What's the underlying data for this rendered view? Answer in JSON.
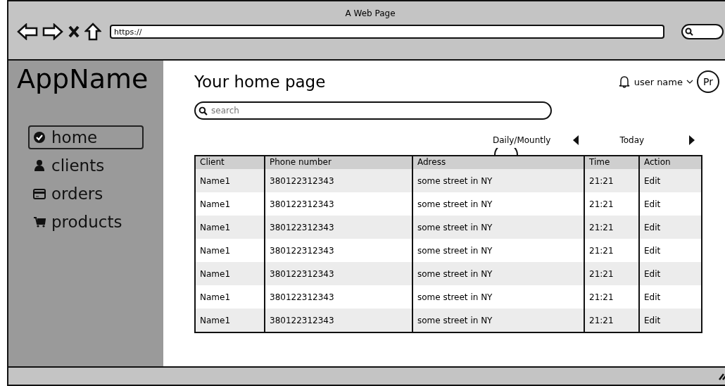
{
  "window": {
    "title": "A Web Page"
  },
  "address_bar": {
    "value": "https://"
  },
  "app_name": "AppName",
  "sidebar": {
    "items": [
      {
        "label": "home",
        "selected": true
      },
      {
        "label": "clients",
        "selected": false
      },
      {
        "label": "orders",
        "selected": false
      },
      {
        "label": "products",
        "selected": false
      }
    ]
  },
  "page_title": "Your home page",
  "user": {
    "name": "user name",
    "avatar": "Pr"
  },
  "search": {
    "placeholder": "search"
  },
  "filter": {
    "toggle_label": "Daily/Mountly",
    "period": "Today"
  },
  "table": {
    "columns": [
      "Client",
      "Phone number",
      "Adress",
      "Time",
      "Action"
    ],
    "rows": [
      [
        "Name1",
        "380122312343",
        "some street in NY",
        "21:21",
        "Edit"
      ],
      [
        "Name1",
        "380122312343",
        "some street in NY",
        "21:21",
        "Edit"
      ],
      [
        "Name1",
        "380122312343",
        "some street in NY",
        "21:21",
        "Edit"
      ],
      [
        "Name1",
        "380122312343",
        "some street in NY",
        "21:21",
        "Edit"
      ],
      [
        "Name1",
        "380122312343",
        "some street in NY",
        "21:21",
        "Edit"
      ],
      [
        "Name1",
        "380122312343",
        "some street in NY",
        "21:21",
        "Edit"
      ],
      [
        "Name1",
        "380122312343",
        "some street in NY",
        "21:21",
        "Edit"
      ]
    ]
  }
}
